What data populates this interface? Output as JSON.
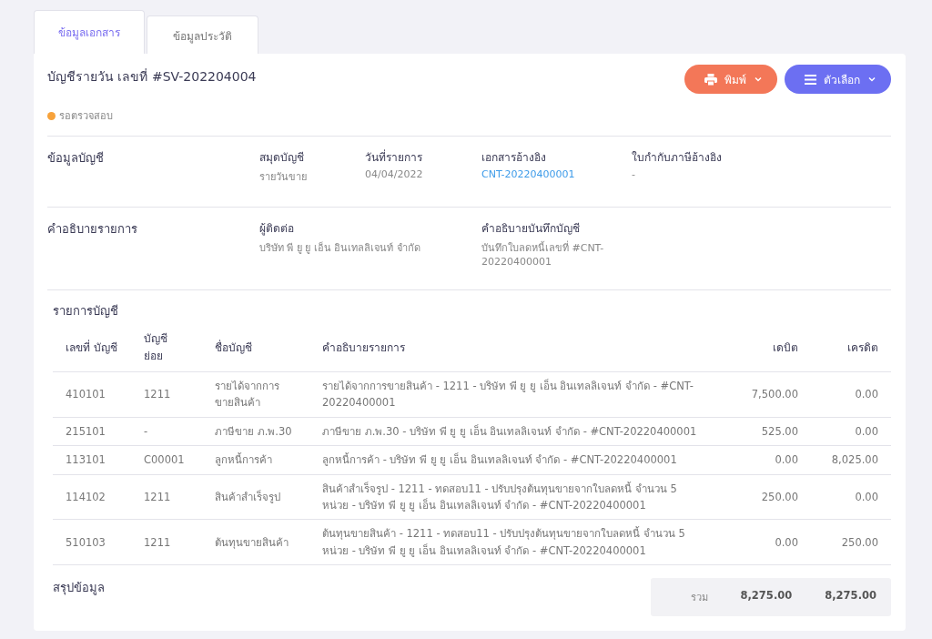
{
  "tabs": [
    {
      "label": "ข้อมูลเอกสาร",
      "selected": true
    },
    {
      "label": "ข้อมูลประวัติ",
      "selected": false
    }
  ],
  "document": {
    "title": "บัญชีรายวัน เลขที่ #SV-202204004",
    "status": {
      "label": "รอตรวจสอบ",
      "color": "#f7a23b"
    }
  },
  "buttons": [
    {
      "kind": "print",
      "label": "พิมพ์",
      "color": "#f37758"
    },
    {
      "kind": "options",
      "label": "ตัวเลือก",
      "color": "#6c6ff2"
    }
  ],
  "sections": [
    {
      "title": "ข้อมูลบัญชี",
      "fields": [
        {
          "label": "สมุดบัญชี",
          "value": "รายวันขาย",
          "kind": "text"
        },
        {
          "label": "วันที่รายการ",
          "value": "04/04/2022",
          "kind": "text"
        },
        {
          "label": "เอกสารอ้างอิง",
          "value": "CNT-20220400001",
          "kind": "link"
        },
        {
          "label": "ใบกำกับภาษีอ้างอิง",
          "value": "-",
          "kind": "text"
        }
      ]
    },
    {
      "title": "คำอธิบายรายการ",
      "fields": [
        {
          "label": "ผู้ติดต่อ",
          "value": "บริษัท พี ยู ยู เอ็น อินเทลลิเจนท์ จำกัด",
          "kind": "text"
        },
        {
          "label": "คำอธิบายบันทึกบัญชี",
          "value": "บันทึกใบลดหนี้เลขที่ #CNT-20220400001",
          "kind": "text"
        }
      ]
    }
  ],
  "table": {
    "title": "รายการบัญชี",
    "columns": [
      "เลขที่ บัญชี",
      "บัญชี ย่อย",
      "ชื่อบัญชี",
      "คำอธิบายรายการ",
      "เดบิต",
      "เครดิต"
    ],
    "rows": [
      [
        "410101",
        "1211",
        "รายได้จากการขายสินค้า",
        "รายได้จากการขายสินค้า - 1211 - บริษัท พี ยู ยู เอ็น อินเทลลิเจนท์ จำกัด - #CNT-20220400001",
        "7,500.00",
        "0.00"
      ],
      [
        "215101",
        "-",
        "ภาษีขาย ภ.พ.30",
        "ภาษีขาย ภ.พ.30 - บริษัท พี ยู ยู เอ็น อินเทลลิเจนท์ จำกัด - #CNT-20220400001",
        "525.00",
        "0.00"
      ],
      [
        "113101",
        "C00001",
        "ลูกหนี้การค้า",
        "ลูกหนี้การค้า - บริษัท พี ยู ยู เอ็น อินเทลลิเจนท์ จำกัด - #CNT-20220400001",
        "0.00",
        "8,025.00"
      ],
      [
        "114102",
        "1211",
        "สินค้าสำเร็จรูป",
        "สินค้าสำเร็จรูป - 1211 - ทดสอบ11 - ปรับปรุงต้นทุนขายจากใบลดหนี้ จำนวน 5 หน่วย - บริษัท พี ยู ยู เอ็น อินเทลลิเจนท์ จำกัด - #CNT-20220400001",
        "250.00",
        "0.00"
      ],
      [
        "510103",
        "1211",
        "ต้นทุนขายสินค้า",
        "ต้นทุนขายสินค้า - 1211 - ทดสอบ11 - ปรับปรุงต้นทุนขายจากใบลดหนี้ จำนวน 5 หน่วย - บริษัท พี ยู ยู เอ็น อินเทลลิเจนท์ จำกัด - #CNT-20220400001",
        "0.00",
        "250.00"
      ]
    ]
  },
  "summary": {
    "title": "สรุปข้อมูล",
    "label": "รวม",
    "debit": "8,275.00",
    "credit": "8,275.00"
  }
}
